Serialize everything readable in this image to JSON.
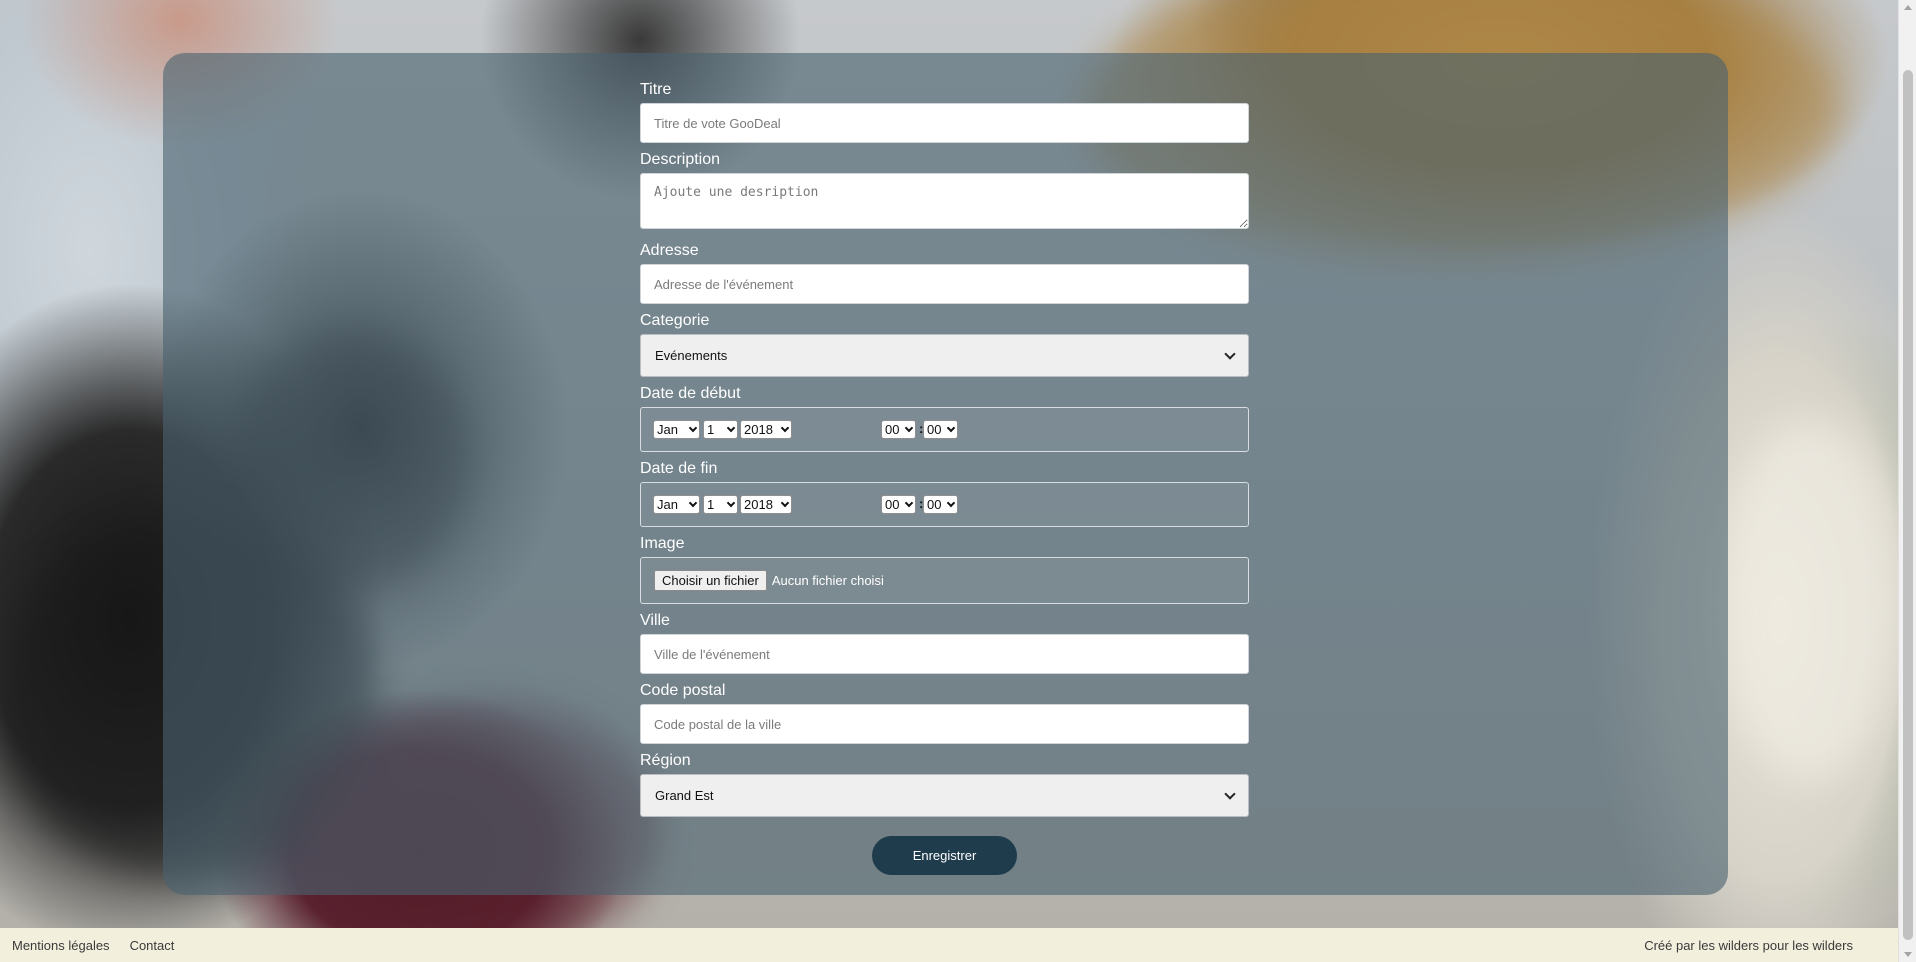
{
  "form": {
    "titre": {
      "label": "Titre",
      "placeholder": "Titre de vote GooDeal"
    },
    "description": {
      "label": "Description",
      "placeholder": "Ajoute une desription"
    },
    "adresse": {
      "label": "Adresse",
      "placeholder": "Adresse de l'événement"
    },
    "categorie": {
      "label": "Categorie",
      "selected": "Evénements"
    },
    "date_debut": {
      "label": "Date de début",
      "month": "Jan",
      "day": "1",
      "year": "2018",
      "hour": "00",
      "minute": "00",
      "separator": ":"
    },
    "date_fin": {
      "label": "Date de fin",
      "month": "Jan",
      "day": "1",
      "year": "2018",
      "hour": "00",
      "minute": "00",
      "separator": ":"
    },
    "image": {
      "label": "Image",
      "button": "Choisir un fichier",
      "status": "Aucun fichier choisi"
    },
    "ville": {
      "label": "Ville",
      "placeholder": "Ville de l'événement"
    },
    "code_postal": {
      "label": "Code postal",
      "placeholder": "Code postal de la ville"
    },
    "region": {
      "label": "Région",
      "selected": "Grand Est"
    },
    "submit": "Enregistrer"
  },
  "footer": {
    "mentions": "Mentions légales",
    "contact": "Contact",
    "credit": "Créé par les wilders pour les wilders"
  },
  "colors": {
    "panel": "#4a6270",
    "button": "#1f3c4d",
    "footer": "#f2f0dd"
  }
}
